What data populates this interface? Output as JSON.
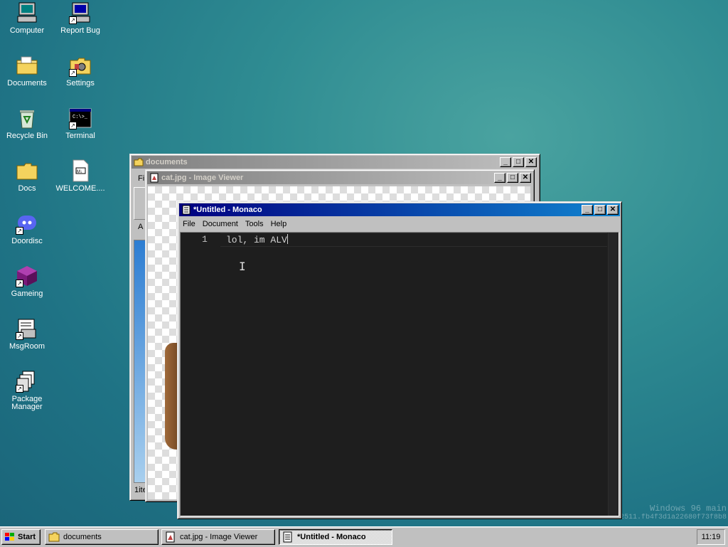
{
  "desktop": {
    "icons": [
      {
        "label": "Computer"
      },
      {
        "label": "Report Bug"
      },
      {
        "label": "Documents"
      },
      {
        "label": "Settings"
      },
      {
        "label": "Recycle Bin"
      },
      {
        "label": "Terminal"
      },
      {
        "label": "Docs"
      },
      {
        "label": "WELCOME...."
      },
      {
        "label": "Doordisc"
      },
      {
        "label": "Gameing"
      },
      {
        "label": "MsgRoom"
      },
      {
        "label": "Package Manager"
      }
    ],
    "watermark_line1": "Windows 96 main",
    "watermark_line2": "build 1264c.0023..c5.2203.4-2511.fb4f3d1a22680f73f8b8"
  },
  "windows": {
    "documents": {
      "title": "documents",
      "menu_first": "Fi",
      "addr_first": "A",
      "status": "1ite"
    },
    "image_viewer": {
      "title": "cat.jpg - Image Viewer"
    },
    "editor": {
      "title": "*Untitled - Monaco",
      "menu": [
        "File",
        "Document",
        "Tools",
        "Help"
      ],
      "line_number": "1",
      "line_text": "lol, im ALV"
    }
  },
  "taskbar": {
    "start_label": "Start",
    "tasks": [
      {
        "label": "documents"
      },
      {
        "label": "cat.jpg - Image Viewer"
      },
      {
        "label": "*Untitled - Monaco"
      }
    ],
    "clock": "11:19"
  },
  "colors": {
    "title_active": "#000080",
    "title_inactive": "#808080",
    "editor_bg": "#1e1e1e",
    "desktop": "#2f8c92"
  }
}
